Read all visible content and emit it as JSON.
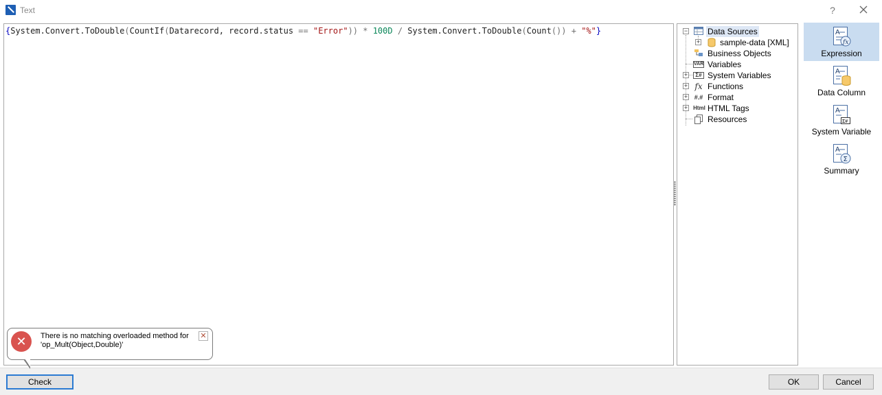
{
  "window": {
    "title": "Text",
    "help_label": "?",
    "close_label": "✕"
  },
  "editor": {
    "tokens": {
      "open_brace": "{",
      "call1": "System.Convert.ToDouble",
      "p1": "(",
      "countif": "CountIf",
      "p2": "(",
      "args": "Datarecord, record.status",
      "eq": " == ",
      "str": "\"Error\"",
      "close1": "))",
      "mul": " * ",
      "num": "100D",
      "div": " / ",
      "call2": "System.Convert.ToDouble",
      "p3": "(",
      "count": "Count",
      "close2": "())",
      "plus": " + ",
      "pct": "\"%\"",
      "close_brace": "}"
    }
  },
  "tree": {
    "items": [
      {
        "label": "Data Sources",
        "icon": "datasource-icon",
        "expander": "−"
      },
      {
        "label": "sample-data [XML]",
        "icon": "database-icon",
        "expander": "+"
      },
      {
        "label": "Business Objects",
        "icon": "business-objects-icon",
        "expander": ""
      },
      {
        "label": "Variables",
        "icon": "variables-icon",
        "expander": "",
        "icon_text": "VAR"
      },
      {
        "label": "System Variables",
        "icon": "system-variables-icon",
        "expander": "+",
        "icon_text": "Σ#"
      },
      {
        "label": "Functions",
        "icon": "functions-icon",
        "expander": "+",
        "icon_text": "fx"
      },
      {
        "label": "Format",
        "icon": "format-icon",
        "expander": "+",
        "icon_text": "#.#"
      },
      {
        "label": "HTML Tags",
        "icon": "html-tags-icon",
        "expander": "+",
        "icon_text": "Html"
      },
      {
        "label": "Resources",
        "icon": "resources-icon",
        "expander": ""
      }
    ]
  },
  "side_panel": {
    "buttons": [
      {
        "label": "Expression",
        "icon": "expression-icon",
        "active": true
      },
      {
        "label": "Data Column",
        "icon": "data-column-icon",
        "active": false
      },
      {
        "label": "System Variable",
        "icon": "system-variable-icon",
        "active": false
      },
      {
        "label": "Summary",
        "icon": "summary-icon",
        "active": false
      }
    ]
  },
  "error_balloon": {
    "icon": "✕",
    "message_line1": "There is no matching overloaded method for",
    "message_line2": "'op_Mult(Object,Double)'",
    "close_label": "✕"
  },
  "footer": {
    "check_label": "Check",
    "ok_label": "OK",
    "cancel_label": "Cancel"
  },
  "colors": {
    "accent": "#1e5fb4",
    "selection": "#c9dcf0",
    "error": "#d9534f"
  }
}
